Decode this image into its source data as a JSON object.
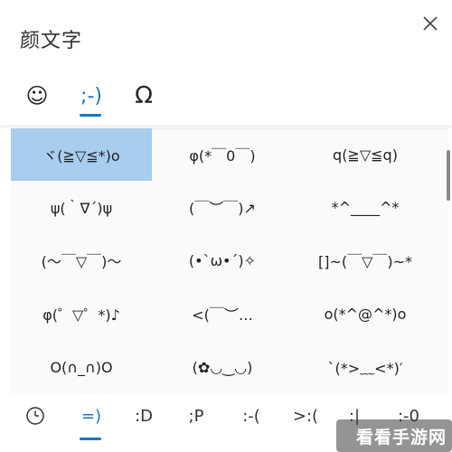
{
  "header": {
    "title": "颜文字"
  },
  "tabs": [
    {
      "label": "☺",
      "icon": "smiley-icon"
    },
    {
      "label": ";-)",
      "icon": "kaomoji-icon"
    },
    {
      "label": "Ω",
      "icon": "omega-icon"
    }
  ],
  "grid": {
    "rows": [
      [
        "ヾ(≧▽≦*)o",
        "φ(*￣0￣)",
        "q(≧▽≦q)"
      ],
      [
        "ψ(｀∇´)ψ",
        "(￣︶￣)↗",
        "*^____^*"
      ],
      [
        "(～￣▽￣)～",
        "(•`ω•´)✧",
        "[]~(￣▽￣)~*"
      ],
      [
        "φ(゜▽゜*)♪",
        "<(￣︶…",
        "o(*^@^*)o"
      ],
      [
        "O(∩_∩)O",
        "(✿◡‿◡)",
        "`(*>﹏<*)′"
      ]
    ]
  },
  "bottom_tabs": [
    {
      "label": "",
      "icon": "clock-icon"
    },
    {
      "label": "=)"
    },
    {
      "label": ":D"
    },
    {
      "label": ";P"
    },
    {
      "label": ":-("
    },
    {
      "label": ">:("
    },
    {
      "label": ":|"
    },
    {
      "label": ":-0"
    }
  ],
  "watermark": {
    "text": "看看手游网"
  },
  "colors": {
    "accent": "#1a73c9",
    "selected": "#a9cdee"
  }
}
